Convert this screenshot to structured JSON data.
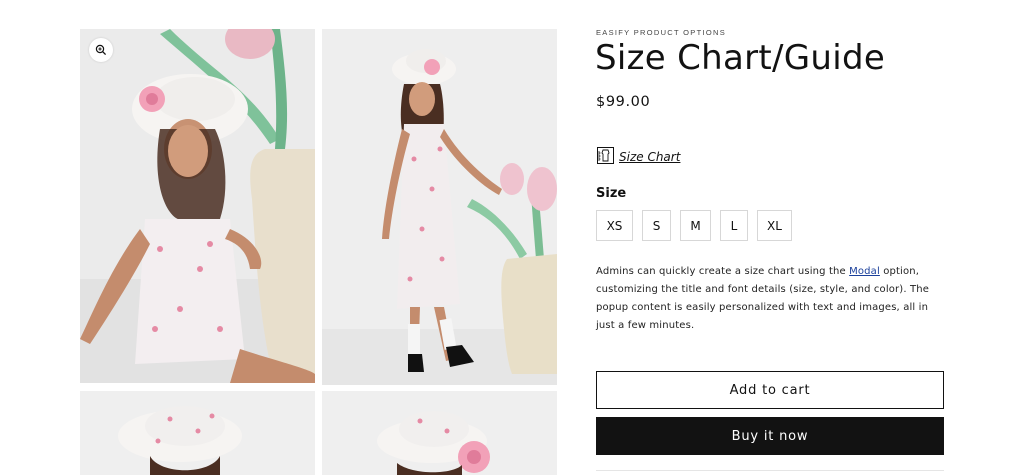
{
  "product": {
    "vendor": "EASIFY PRODUCT OPTIONS",
    "title": "Size Chart/Guide",
    "price": "$99.00"
  },
  "size_chart": {
    "label": "Size Chart",
    "icon": "size-chart-icon"
  },
  "size_option": {
    "label": "Size",
    "values": [
      "XS",
      "S",
      "M",
      "L",
      "XL"
    ]
  },
  "description": {
    "part1": "Admins can quickly create a size chart using the ",
    "link": "Modal",
    "part2": " option, customizing the title and font details (size, style, and color). The popup content is easily personalized with text and images, all in just a few minutes."
  },
  "buttons": {
    "add_to_cart": "Add to cart",
    "buy_now": "Buy it now"
  },
  "colors": {
    "primary": "#121212",
    "link": "#1a3f9b",
    "border": "#d7d7d7"
  }
}
